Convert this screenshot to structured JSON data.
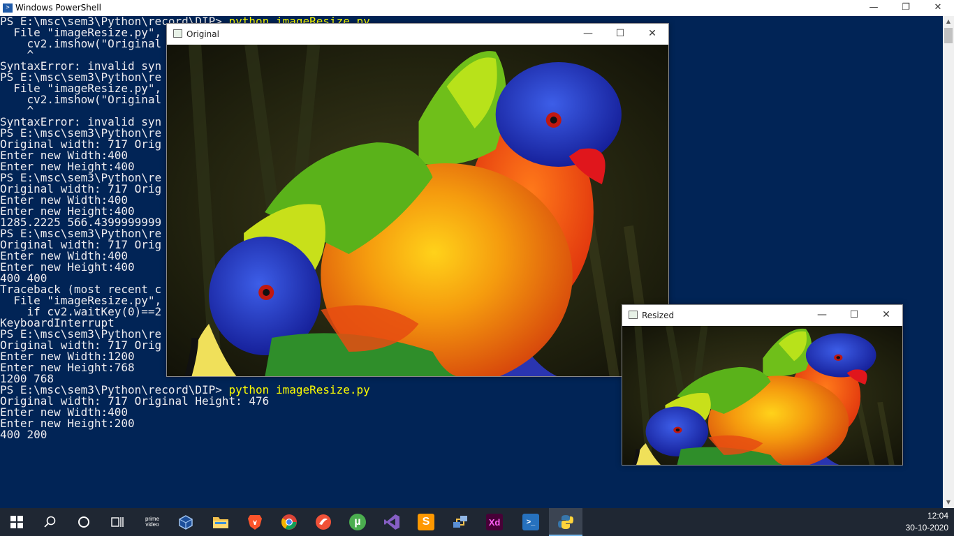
{
  "powershell": {
    "title": "Windows PowerShell",
    "controls": {
      "minimize": "—",
      "maximize": "❐",
      "close": "✕"
    },
    "lines": [
      {
        "text": "PS E:\\msc\\sem3\\Python\\record\\DIP> ",
        "cmd": "python imageResize.py"
      },
      {
        "text": "  File \"imageResize.py\",",
        "cmd": ""
      },
      {
        "text": "    cv2.imshow(\"Original",
        "cmd": ""
      },
      {
        "text": "    ^",
        "cmd": ""
      },
      {
        "text": "SyntaxError: invalid syn",
        "cmd": ""
      },
      {
        "text": "PS E:\\msc\\sem3\\Python\\re",
        "cmd": ""
      },
      {
        "text": "  File \"imageResize.py\",",
        "cmd": ""
      },
      {
        "text": "    cv2.imshow(\"Original",
        "cmd": ""
      },
      {
        "text": "    ^",
        "cmd": ""
      },
      {
        "text": "SyntaxError: invalid syn",
        "cmd": ""
      },
      {
        "text": "PS E:\\msc\\sem3\\Python\\re",
        "cmd": ""
      },
      {
        "text": "Original width: 717 Orig",
        "cmd": ""
      },
      {
        "text": "Enter new Width:400",
        "cmd": ""
      },
      {
        "text": "Enter new Height:400",
        "cmd": ""
      },
      {
        "text": "PS E:\\msc\\sem3\\Python\\re",
        "cmd": ""
      },
      {
        "text": "Original width: 717 Orig",
        "cmd": ""
      },
      {
        "text": "Enter new Width:400",
        "cmd": ""
      },
      {
        "text": "Enter new Height:400",
        "cmd": ""
      },
      {
        "text": "1285.2225 566.4399999999",
        "cmd": ""
      },
      {
        "text": "PS E:\\msc\\sem3\\Python\\re",
        "cmd": ""
      },
      {
        "text": "Original width: 717 Orig",
        "cmd": ""
      },
      {
        "text": "Enter new Width:400",
        "cmd": ""
      },
      {
        "text": "Enter new Height:400",
        "cmd": ""
      },
      {
        "text": "400 400",
        "cmd": ""
      },
      {
        "text": "Traceback (most recent c",
        "cmd": ""
      },
      {
        "text": "  File \"imageResize.py\",",
        "cmd": ""
      },
      {
        "text": "    if cv2.waitKey(0)==2",
        "cmd": ""
      },
      {
        "text": "KeyboardInterrupt",
        "cmd": ""
      },
      {
        "text": "PS E:\\msc\\sem3\\Python\\re",
        "cmd": ""
      },
      {
        "text": "Original width: 717 Orig",
        "cmd": ""
      },
      {
        "text": "Enter new Width:1200",
        "cmd": ""
      },
      {
        "text": "Enter new Height:768",
        "cmd": ""
      },
      {
        "text": "1200 768",
        "cmd": ""
      },
      {
        "text": "PS E:\\msc\\sem3\\Python\\record\\DIP> ",
        "cmd": "python imageResize.py"
      },
      {
        "text": "Original width: 717 Original Height: 476",
        "cmd": ""
      },
      {
        "text": "Enter new Width:400",
        "cmd": ""
      },
      {
        "text": "Enter new Height:200",
        "cmd": ""
      },
      {
        "text": "400 200",
        "cmd": ""
      }
    ]
  },
  "original_window": {
    "title": "Original"
  },
  "resized_window": {
    "title": "Resized"
  },
  "window_controls": {
    "minimize": "—",
    "maximize": "☐",
    "close": "✕"
  },
  "taskbar": {
    "items": [
      {
        "name": "start-button",
        "icon": "windows-logo-icon"
      },
      {
        "name": "search-button",
        "icon": "search-icon"
      },
      {
        "name": "cortana-button",
        "icon": "circle-icon"
      },
      {
        "name": "task-view-button",
        "icon": "task-view-icon"
      },
      {
        "name": "prime-video-button",
        "icon": "prime-video-icon",
        "label": "prime\nvideo"
      },
      {
        "name": "virtualbox-button",
        "icon": "virtualbox-icon"
      },
      {
        "name": "file-explorer-button",
        "icon": "folder-icon"
      },
      {
        "name": "brave-button",
        "icon": "brave-icon"
      },
      {
        "name": "chrome-button",
        "icon": "chrome-icon"
      },
      {
        "name": "swift-button",
        "icon": "swift-icon"
      },
      {
        "name": "utorrent-button",
        "icon": "utorrent-icon",
        "label": "µ"
      },
      {
        "name": "visual-studio-button",
        "icon": "visual-studio-icon"
      },
      {
        "name": "sublime-button",
        "icon": "sublime-text-icon",
        "label": "S"
      },
      {
        "name": "network-app-button",
        "icon": "network-icon"
      },
      {
        "name": "adobe-xd-button",
        "icon": "adobe-xd-icon",
        "label": "Xd"
      },
      {
        "name": "powershell-button",
        "icon": "powershell-icon",
        "label": ">_"
      },
      {
        "name": "python-button",
        "icon": "python-icon"
      }
    ],
    "time": "12:04",
    "date": "30-10-2020"
  },
  "colors": {
    "console_bg": "#012456",
    "console_fg": "#eeedf0",
    "command_fg": "#ffff00",
    "taskbar_bg": "#1f2733"
  }
}
